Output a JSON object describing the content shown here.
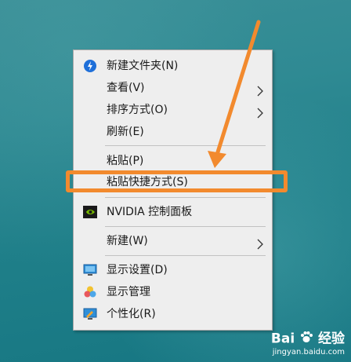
{
  "menu": {
    "items": [
      {
        "label": "新建文件夹(N)",
        "icon": "folder-plus-icon"
      },
      {
        "label": "查看(V)",
        "submenu": true
      },
      {
        "label": "排序方式(O)",
        "submenu": true
      },
      {
        "label": "刷新(E)"
      },
      {
        "label": "粘贴(P)"
      },
      {
        "label": "粘贴快捷方式(S)"
      },
      {
        "label": "NVIDIA 控制面板",
        "icon": "nvidia-icon"
      },
      {
        "label": "新建(W)",
        "submenu": true
      },
      {
        "label": "显示设置(D)",
        "icon": "display-icon"
      },
      {
        "label": "显示管理",
        "icon": "color-wheel-icon"
      },
      {
        "label": "个性化(R)",
        "icon": "personalize-icon"
      }
    ]
  },
  "annotation": {
    "color": "#f28a2e"
  },
  "watermark": {
    "brand": "Bai",
    "brand2": "经验",
    "url": "jingyan.baidu.com"
  }
}
